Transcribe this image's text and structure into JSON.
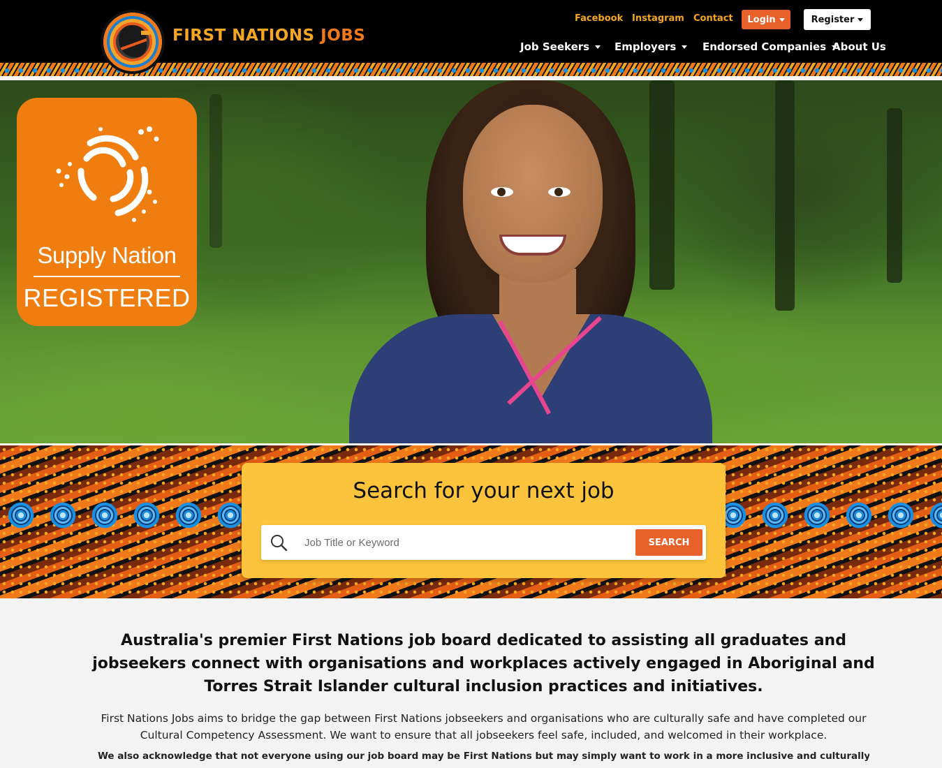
{
  "brand": {
    "name_part1": "FIRST NATIONS",
    "name_part2": "JOBS"
  },
  "toplinks": {
    "facebook": "Facebook",
    "instagram": "Instagram",
    "contact": "Contact",
    "login": "Login",
    "register": "Register"
  },
  "nav": {
    "job_seekers": "Job Seekers",
    "employers": "Employers",
    "endorsed": "Endorsed Companies",
    "about": "About Us"
  },
  "badge": {
    "line1": "Supply Nation",
    "line2": "REGISTERED"
  },
  "search": {
    "title": "Search for your next job",
    "placeholder": "Job Title or Keyword",
    "button": "SEARCH"
  },
  "content": {
    "lead": "Australia's premier First Nations job board dedicated to assisting all graduates and jobseekers connect with organisations and workplaces actively engaged in Aboriginal and Torres Strait Islander cultural inclusion practices and initiatives.",
    "paragraph": "First Nations Jobs aims to bridge the gap between First Nations jobseekers and organisations who are culturally safe and have completed our Cultural Competency Assessment. We want to ensure that all jobseekers feel safe, included, and welcomed in their workplace.",
    "paragraph2": "We also acknowledge that not everyone using our job board may be First Nations but may simply want to work in a more inclusive and culturally understanding"
  },
  "colors": {
    "accent_orange": "#e8602a",
    "brand_gold": "#f5a623",
    "search_card": "#fcc33c",
    "badge_orange": "#f07d0f"
  },
  "icons": [
    "logo-icon",
    "search-icon",
    "supply-nation-mark-icon",
    "caret-down-icon"
  ]
}
